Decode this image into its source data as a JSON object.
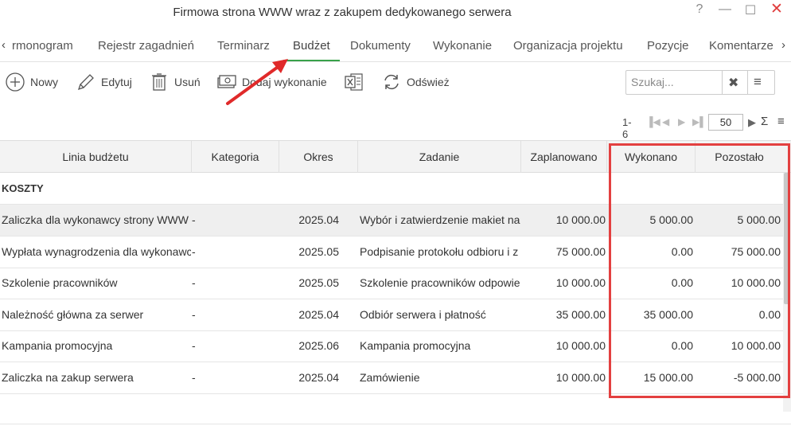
{
  "window": {
    "title": "Firmowa strona WWW wraz z zakupem dedykowanego serwera",
    "help_symbol": "?",
    "minimize_symbol": "—",
    "maximize_symbol": "☐",
    "close_symbol": "✕"
  },
  "tabs": {
    "scroll_left_symbol": "‹",
    "scroll_right_symbol": "›",
    "items": [
      {
        "label": "rmonogram"
      },
      {
        "label": "Rejestr zagadnień"
      },
      {
        "label": "Terminarz"
      },
      {
        "label": "Budżet"
      },
      {
        "label": "Dokumenty"
      },
      {
        "label": "Wykonanie"
      },
      {
        "label": "Organizacja projektu"
      },
      {
        "label": "Pozycje"
      },
      {
        "label": "Komentarze"
      }
    ],
    "active_index": 3,
    "active_color": "#38a24a"
  },
  "toolbar": {
    "new_label": "Nowy",
    "edit_label": "Edytuj",
    "delete_label": "Usuń",
    "add_execution_label": "Dodaj wykonanie",
    "refresh_label": "Odśwież",
    "excel_icon": "excel-export-icon"
  },
  "search": {
    "placeholder": "Szukaj...",
    "clear_symbol": "✖",
    "menu_symbol": "≡"
  },
  "pager": {
    "range": "1-6",
    "page_size": "50",
    "sum_symbol": "Σ",
    "menu_symbol": "≡"
  },
  "table": {
    "columns": [
      "Linia budżetu",
      "Kategoria",
      "Okres",
      "Zadanie",
      "Zaplanowano",
      "Wykonano",
      "Pozostało"
    ],
    "group_label": "KOSZTY",
    "rows": [
      {
        "line": "Zaliczka dla wykonawcy strony WWW",
        "category": "-",
        "period": "2025.04",
        "task": "Wybór i zatwierdzenie makiet na",
        "planned": "10 000.00",
        "done": "5 000.00",
        "remaining": "5 000.00"
      },
      {
        "line": "Wypłata wynagrodzenia dla wykonawc",
        "category": "-",
        "period": "2025.05",
        "task": "Podpisanie protokołu odbioru i z",
        "planned": "75 000.00",
        "done": "0.00",
        "remaining": "75 000.00"
      },
      {
        "line": "Szkolenie pracowników",
        "category": "-",
        "period": "2025.05",
        "task": "Szkolenie pracowników odpowie",
        "planned": "10 000.00",
        "done": "0.00",
        "remaining": "10 000.00"
      },
      {
        "line": "Należność główna za serwer",
        "category": "-",
        "period": "2025.04",
        "task": "Odbiór serwera i płatność",
        "planned": "35 000.00",
        "done": "35 000.00",
        "remaining": "0.00"
      },
      {
        "line": "Kampania promocyjna",
        "category": "-",
        "period": "2025.06",
        "task": "Kampania promocyjna",
        "planned": "10 000.00",
        "done": "0.00",
        "remaining": "10 000.00"
      },
      {
        "line": "Zaliczka na zakup serwera",
        "category": "-",
        "period": "2025.04",
        "task": "Zamówienie",
        "planned": "10 000.00",
        "done": "15 000.00",
        "remaining": "-5 000.00"
      }
    ]
  },
  "annotation": {
    "highlight_color": "#e34040"
  }
}
